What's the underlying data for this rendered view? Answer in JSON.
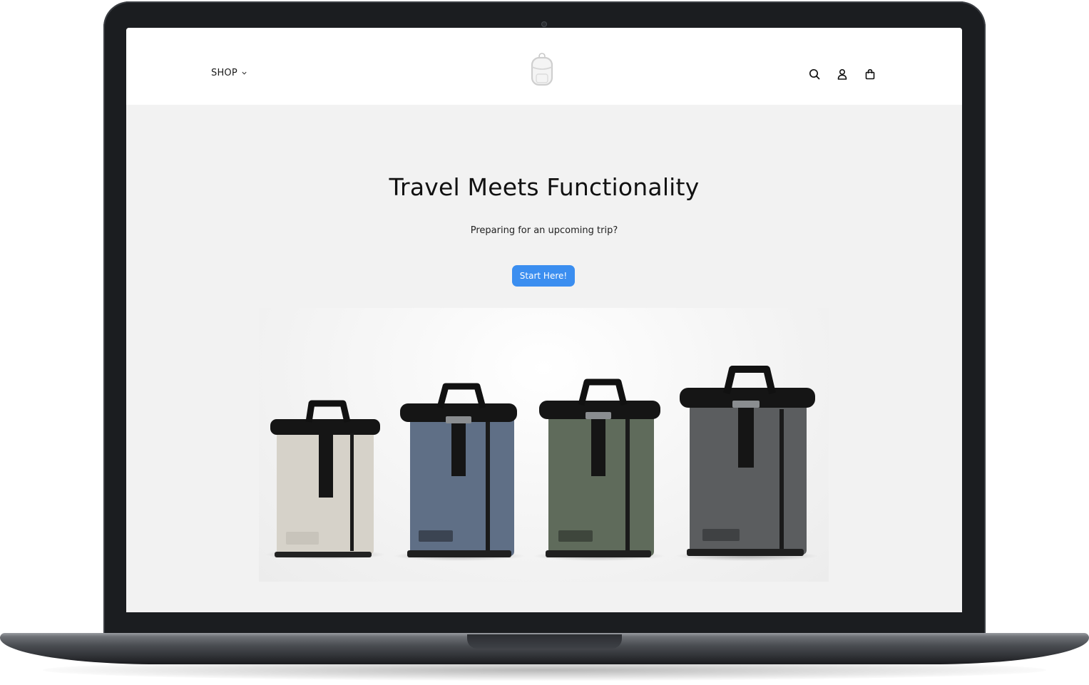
{
  "nav": {
    "shop_label": "SHOP"
  },
  "icons": {
    "dropdown": "chevron-down-icon",
    "logo": "backpack-logo-icon",
    "search": "search-icon",
    "account": "user-icon",
    "cart": "shopping-bag-icon"
  },
  "hero": {
    "title": "Travel Meets Functionality",
    "subtitle": "Preparing for an upcoming trip?",
    "cta_label": "Start Here!",
    "cta_color": "#3b8ef0"
  },
  "products": {
    "backpacks": [
      {
        "color": "sand",
        "hex": "#d6d2c9"
      },
      {
        "color": "blue",
        "hex": "#5f6f86"
      },
      {
        "color": "green",
        "hex": "#5f6b5b"
      },
      {
        "color": "charcoal",
        "hex": "#5b5d5f"
      }
    ]
  },
  "colors": {
    "page_background": "#f2f2f2",
    "header_background": "#ffffff",
    "laptop_frame": "#1b1d20"
  }
}
